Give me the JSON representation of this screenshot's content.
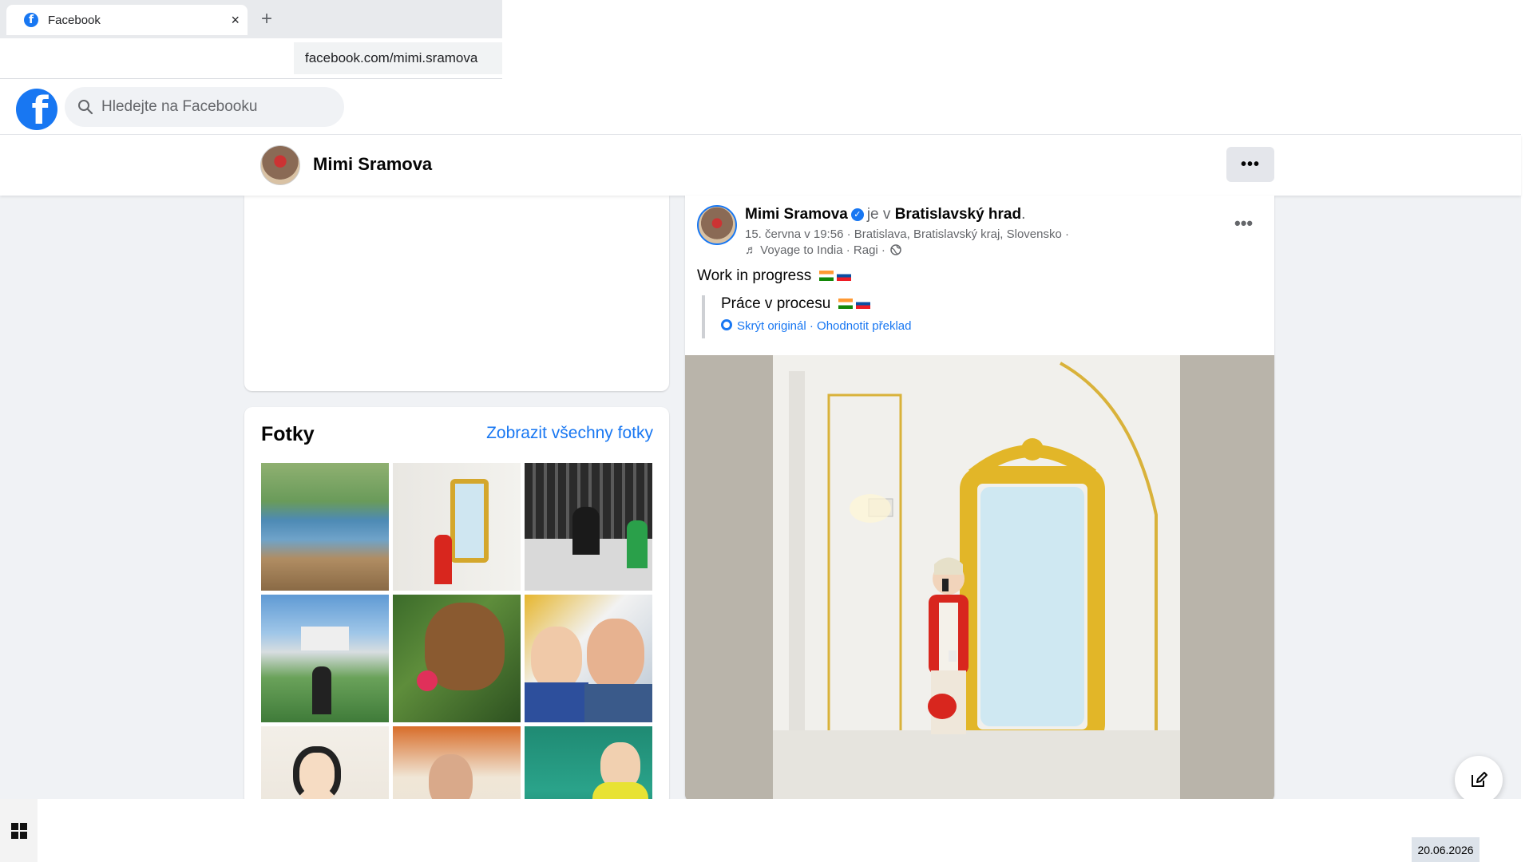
{
  "browser": {
    "tab_title": "Facebook",
    "tab_close": "×",
    "new_tab": "+",
    "url": "facebook.com/mimi.sramova"
  },
  "facebook": {
    "logo_letter": "f",
    "search_placeholder": "Hledejte na Facebooku"
  },
  "profile": {
    "name": "Mimi Sramova",
    "more_label": "•••"
  },
  "photos": {
    "title": "Fotky",
    "see_all": "Zobrazit všechny fotky",
    "count_visible": 9
  },
  "post": {
    "author": "Mimi Sramova",
    "verified_mark": "✓",
    "is_at": "je v",
    "place": "Bratislavský hrad",
    "period": ".",
    "meta_line1": "15. června v 19:56 · Bratislava, Bratislavský kraj, Slovensko ·",
    "meta_line2": "♬ Voyage to India · Ragi ·",
    "menu": "•••",
    "text": "Work in progress",
    "translation": "Práce v procesu",
    "hide_original": "Skrýt originál",
    "separator": "·",
    "rate_translation": "Ohodnotit překlad"
  },
  "taskbar": {
    "date": "20.06.2026"
  },
  "colors": {
    "accent": "#1877f2",
    "page_bg": "#f0f2f5",
    "secondary_text": "#65676b"
  },
  "icons": {
    "search": "search-icon",
    "globe": "globe-icon",
    "compose": "compose-icon",
    "windows": "windows-icon"
  }
}
